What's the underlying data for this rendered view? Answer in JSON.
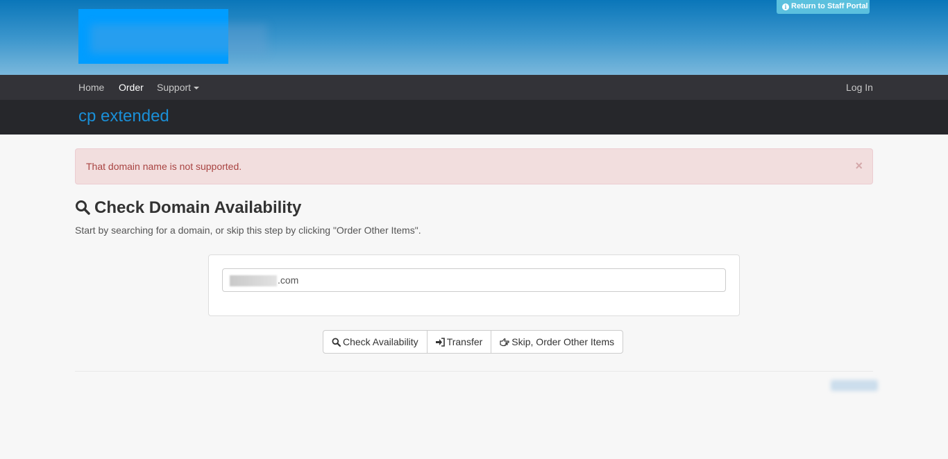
{
  "header": {
    "staff_portal_label": "Return to Staff Portal",
    "info_glyph": "i"
  },
  "nav": {
    "items": [
      {
        "label": "Home"
      },
      {
        "label": "Order"
      },
      {
        "label": "Support"
      }
    ],
    "login_label": "Log In"
  },
  "page": {
    "title": "cp extended"
  },
  "alert": {
    "message": "That domain name is not supported.",
    "close_glyph": "×"
  },
  "domain_check": {
    "heading": "Check Domain Availability",
    "lead": "Start by searching for a domain, or skip this step by clicking \"Order Other Items\".",
    "input_value": ".com"
  },
  "buttons": {
    "check_label": "Check Availability",
    "transfer_label": "Transfer",
    "skip_label": "Skip, Order Other Items"
  },
  "colors": {
    "brand_blue": "#1a8fd7",
    "alert_text": "#a94442",
    "alert_bg": "#f2dede",
    "staff_btn": "#5bc0de"
  }
}
